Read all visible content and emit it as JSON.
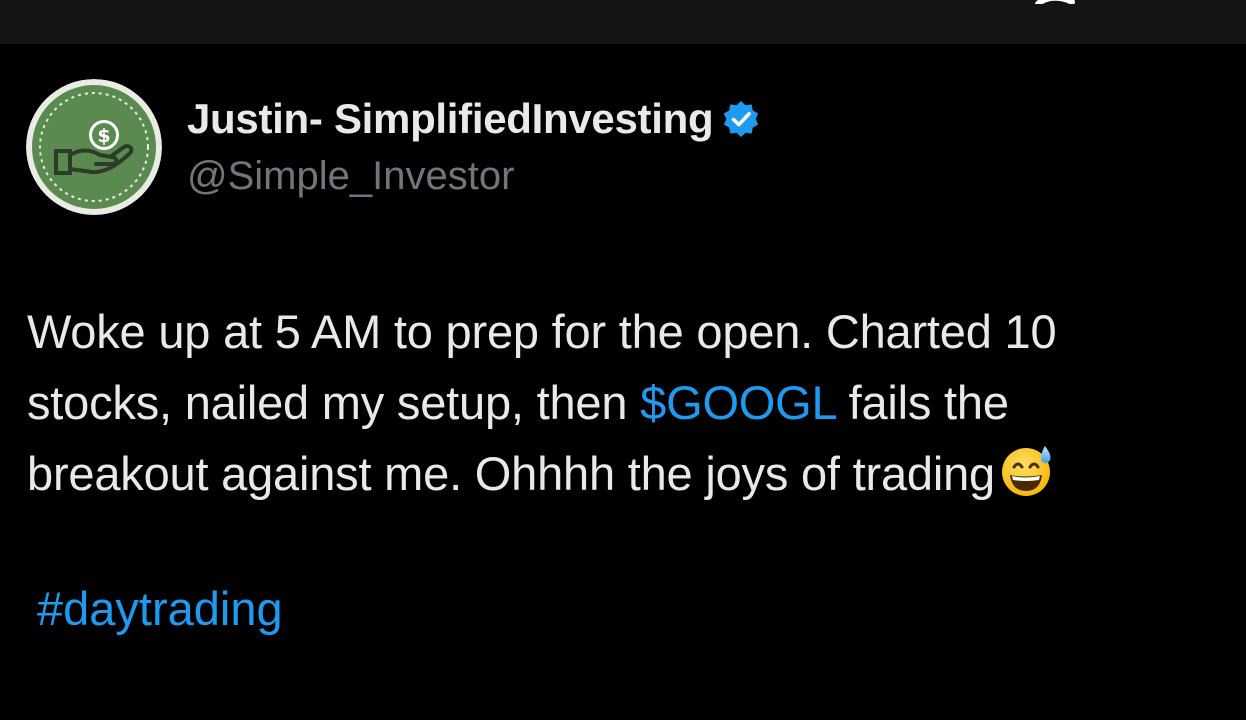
{
  "tweet": {
    "author": {
      "display_name": "Justin- SimplifiedInvesting",
      "handle": "@Simple_Investor",
      "verified": true,
      "avatar_icon": "money-hand-icon"
    },
    "text": {
      "line1": "Woke up at 5 AM to prep for the open. Charted 10",
      "line2_before": "stocks, nailed my setup, then ",
      "cashtag": "$GOOGL",
      "line2_after": " fails the",
      "line3": "breakout against me. Ohhhh the joys of trading",
      "emoji": "grinning-face-with-sweat-emoji"
    },
    "hashtag": "#daytrading"
  },
  "colors": {
    "background": "#000000",
    "top_bar": "#141414",
    "text_primary": "#e7e9ea",
    "text_secondary": "#71767b",
    "link": "#1d9bf0",
    "verified_badge": "#1d9bf0",
    "avatar_green": "#5a8a4f"
  }
}
